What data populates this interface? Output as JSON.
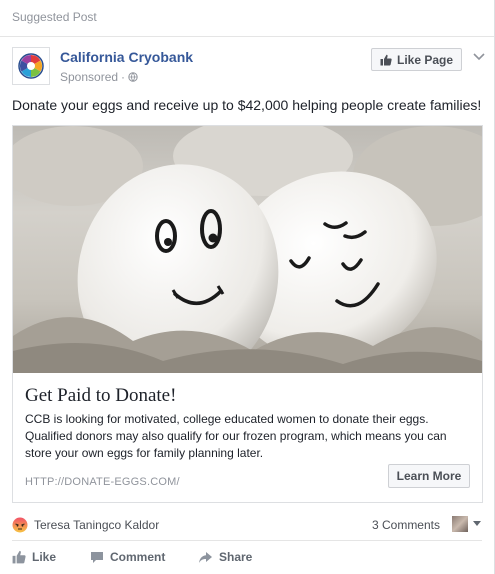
{
  "header": {
    "label": "Suggested Post"
  },
  "page": {
    "name": "California Cryobank",
    "sponsored_label": "Sponsored",
    "separator": "·",
    "like_page_label": "Like Page"
  },
  "post": {
    "text": "Donate your eggs and receive up to $42,000 helping people create families!"
  },
  "attachment": {
    "headline": "Get Paid to Donate!",
    "description": "CCB is looking for motivated, college educated women to donate their eggs. Qualified donors may also qualify for our frozen program, which means you can store your own eggs for family planning later.",
    "link_caption": "HTTP://DONATE-EGGS.COM/",
    "cta_label": "Learn More"
  },
  "engagement": {
    "reactor_name": "Teresa Taningco Kaldor",
    "comments_label": "3 Comments"
  },
  "actions": {
    "like": "Like",
    "comment": "Comment",
    "share": "Share"
  },
  "icons": {
    "reaction": "angry-reaction-icon",
    "globe": "globe-icon",
    "thumb": "thumbs-up-icon",
    "comment": "comment-icon",
    "share": "share-arrow-icon"
  },
  "colors": {
    "link": "#365899",
    "muted": "#90949c",
    "action": "#606770",
    "button_bg": "#f6f7f9"
  }
}
